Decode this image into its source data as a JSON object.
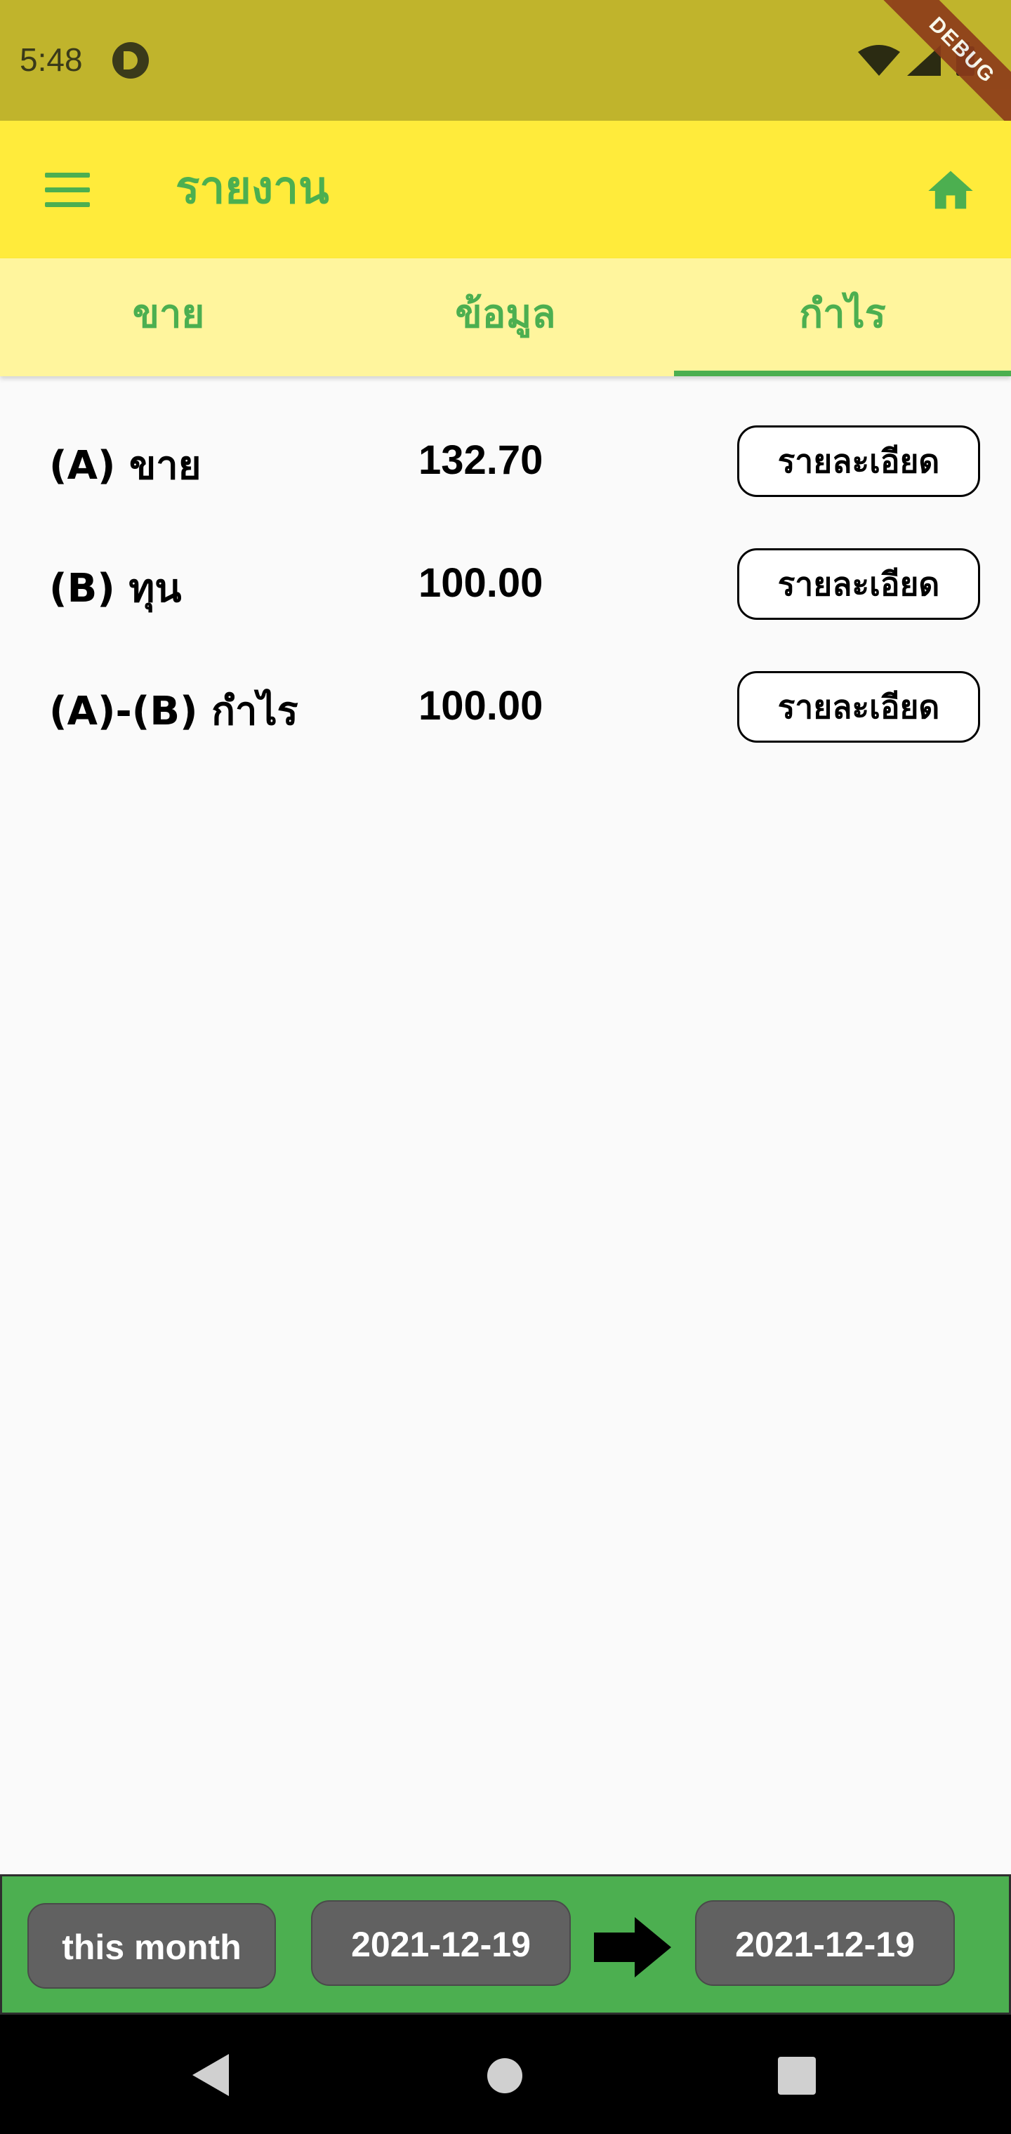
{
  "status_bar": {
    "time": "5:48",
    "debug_label": "DEBUG",
    "icons": [
      "record-icon",
      "wifi-icon",
      "signal-icon",
      "battery-icon"
    ]
  },
  "app_bar": {
    "title": "รายงาน",
    "menu_icon": "menu-icon",
    "home_icon": "home-icon",
    "background": "#ffeb3b",
    "accent": "#4caf50"
  },
  "tabs": [
    {
      "label": "ขาย",
      "active": false
    },
    {
      "label": "ข้อมูล",
      "active": false
    },
    {
      "label": "กำไร",
      "active": true
    }
  ],
  "report": [
    {
      "label": "(A) ขาย",
      "value": "132.70",
      "button": "รายละเอียด"
    },
    {
      "label": "(B) ทุน",
      "value": "100.00",
      "button": "รายละเอียด"
    },
    {
      "label": "(A)-(B) กำไร",
      "value": "100.00",
      "button": "รายละเอียด"
    }
  ],
  "date_range": {
    "preset": "this month",
    "start": "2021-12-19",
    "end": "2021-12-19",
    "arrow_icon": "arrow-right-icon",
    "panel_color": "#4caf50",
    "pill_color": "#616161"
  },
  "nav_bar": {
    "icons": [
      "back-icon",
      "home-circle-icon",
      "recent-apps-icon"
    ]
  }
}
